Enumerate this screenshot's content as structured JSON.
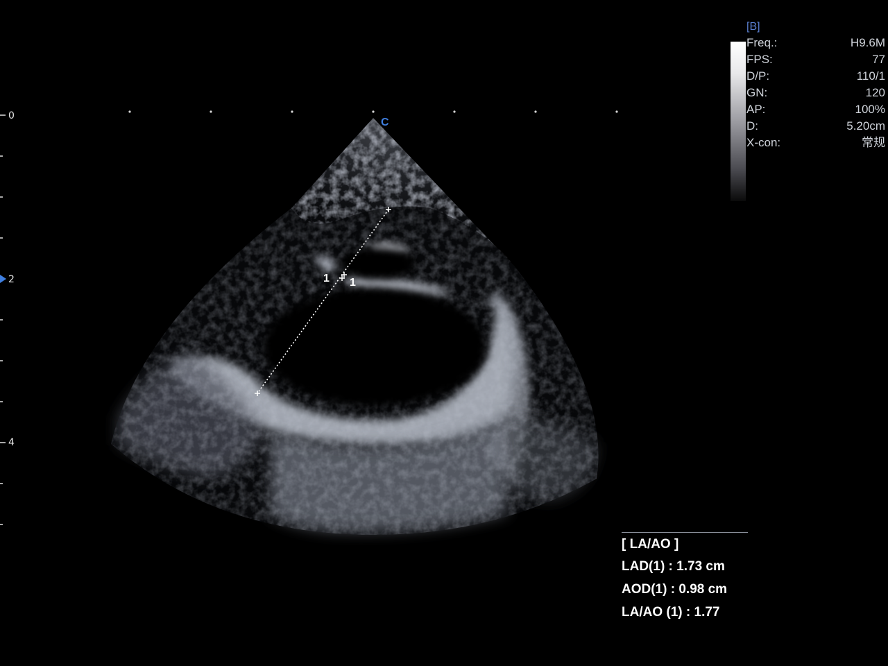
{
  "app": {
    "mode_tag": "[B]",
    "probe_orientation_mark": "C",
    "focus_marker_icon": "triangle-right-icon"
  },
  "depth_scale": {
    "labels": [
      "0",
      "2",
      "4"
    ]
  },
  "parameters": [
    {
      "label": "Freq.:",
      "value": "H9.6M"
    },
    {
      "label": "FPS:",
      "value": "77"
    },
    {
      "label": "D/P:",
      "value": "110/1"
    },
    {
      "label": "GN:",
      "value": "120"
    },
    {
      "label": "AP:",
      "value": "100%"
    },
    {
      "label": "D:",
      "value": "5.20cm"
    },
    {
      "label": "X-con:",
      "value": "常规"
    }
  ],
  "calipers": {
    "line1_label": "1",
    "line2_label": "1"
  },
  "measurement": {
    "title": "[ LA/AO ]",
    "rows": [
      {
        "label": "LAD(1) :",
        "value": "1.73 cm"
      },
      {
        "label": "AOD(1) :",
        "value": "0.98 cm"
      },
      {
        "label": "LA/AO (1) :",
        "value": "1.77"
      }
    ]
  },
  "colors": {
    "background": "#000000",
    "accent_blue": "#3f7fe0",
    "text": "#ffffff",
    "param_text": "#cfd3da"
  }
}
